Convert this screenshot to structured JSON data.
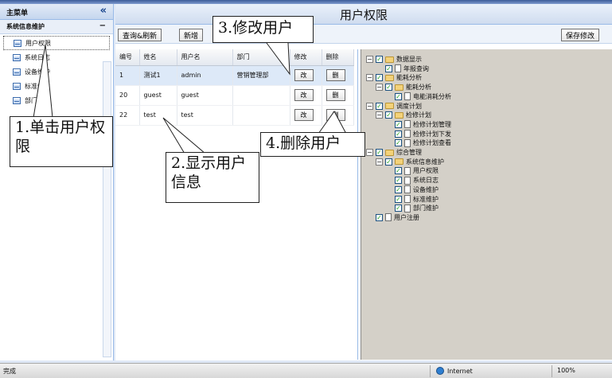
{
  "nav": {
    "header_title": "主菜单",
    "collapse_glyph": "«",
    "group_title": "系统信息维护",
    "group_toggle": "−",
    "items": [
      {
        "label": "用户权限",
        "icon": "grid-icon"
      },
      {
        "label": "系统日志",
        "icon": "grid-icon"
      },
      {
        "label": "设备维护",
        "icon": "grid-icon"
      },
      {
        "label": "标准维护",
        "icon": "grid-icon"
      },
      {
        "label": "部门维护",
        "icon": "grid-icon"
      }
    ]
  },
  "main": {
    "title": "用户权限",
    "toolbar": {
      "query_label": "查询&刷新",
      "add_label": "新增",
      "save_label": "保存修改"
    },
    "table": {
      "headers": [
        "编号",
        "姓名",
        "用户名",
        "部门",
        "修改",
        "删除"
      ],
      "edit_button_label": "改",
      "delete_button_label": "删",
      "rows": [
        {
          "id": "1",
          "name": "测试1",
          "username": "admin",
          "dept": "营销管理部"
        },
        {
          "id": "20",
          "name": "guest",
          "username": "guest",
          "dept": ""
        },
        {
          "id": "22",
          "name": "test",
          "username": "test",
          "dept": ""
        }
      ]
    },
    "tree": [
      {
        "label": "数据显示",
        "level": 0,
        "type": "folder",
        "toggle": "−"
      },
      {
        "label": "年报查询",
        "level": 1,
        "type": "file"
      },
      {
        "label": "能耗分析",
        "level": 0,
        "type": "folder",
        "toggle": "−"
      },
      {
        "label": "能耗分析",
        "level": 1,
        "type": "folder",
        "toggle": "−"
      },
      {
        "label": "电能消耗分析",
        "level": 2,
        "type": "file"
      },
      {
        "label": "调度计划",
        "level": 0,
        "type": "folder",
        "toggle": "−"
      },
      {
        "label": "检修计划",
        "level": 1,
        "type": "folder",
        "toggle": "−"
      },
      {
        "label": "检修计划管理",
        "level": 2,
        "type": "file"
      },
      {
        "label": "检修计划下发",
        "level": 2,
        "type": "file"
      },
      {
        "label": "检修计划查看",
        "level": 2,
        "type": "file"
      },
      {
        "label": "综合管理",
        "level": 0,
        "type": "folder",
        "toggle": "−"
      },
      {
        "label": "系统信息维护",
        "level": 1,
        "type": "folder",
        "toggle": "−"
      },
      {
        "label": "用户权限",
        "level": 2,
        "type": "file"
      },
      {
        "label": "系统日志",
        "level": 2,
        "type": "file"
      },
      {
        "label": "设备维护",
        "level": 2,
        "type": "file"
      },
      {
        "label": "标准维护",
        "level": 2,
        "type": "file"
      },
      {
        "label": "部门维护",
        "level": 2,
        "type": "file"
      },
      {
        "label": "用户注册",
        "level": 0,
        "type": "file"
      }
    ]
  },
  "annotations": {
    "step1": "1.单击用户权限",
    "step2": "2.显示用户信息",
    "step3": "3.修改用户",
    "step4": "4.删除用户"
  },
  "status": {
    "left": "完成",
    "zone": "Internet",
    "zoom": "100%"
  },
  "colors": {
    "panel_border": "#99bbe8",
    "header_bg": "#dfe8f6",
    "selected_row": "#dde9f8",
    "tree_bg": "#d4d0c8",
    "folder": "#f3d27a",
    "check": "#21a121"
  }
}
